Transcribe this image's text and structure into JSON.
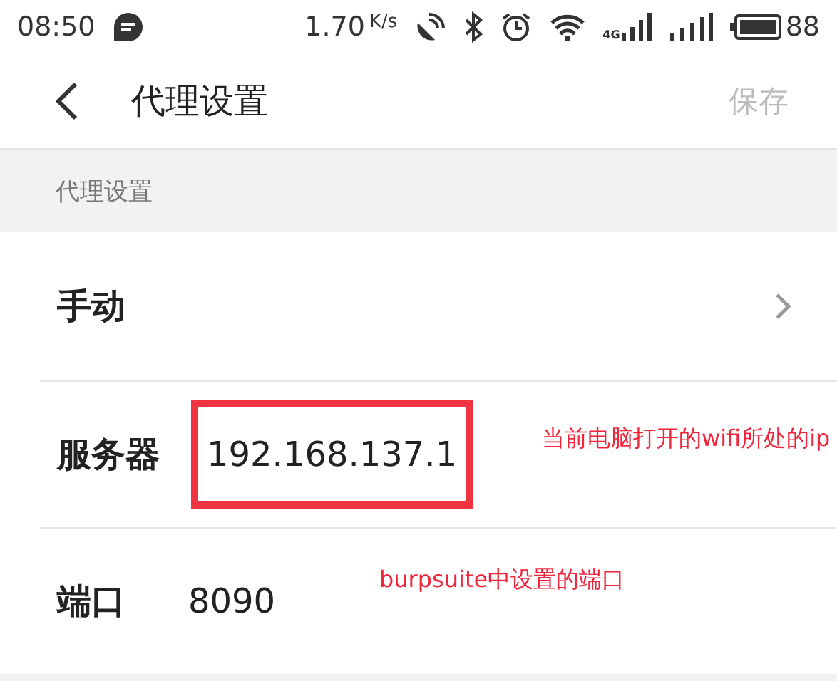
{
  "status_bar": {
    "time": "08:50",
    "speed": "1.70",
    "speed_unit": "K/s",
    "network_type": "4G",
    "battery": "88"
  },
  "header": {
    "title": "代理设置",
    "save": {
      "label": "保存",
      "disabled": true
    }
  },
  "section": {
    "label": "代理设置"
  },
  "rows": [
    {
      "kind": "select",
      "label": "手动"
    },
    {
      "kind": "field",
      "label": "服务器",
      "value": "192.168.137.1",
      "highlighted": true,
      "note": "当前电脑打开的wifi所处的ip"
    },
    {
      "kind": "field",
      "label": "端口",
      "value": "8090",
      "highlighted": false,
      "note": "burpsuite中设置的端口"
    }
  ]
}
